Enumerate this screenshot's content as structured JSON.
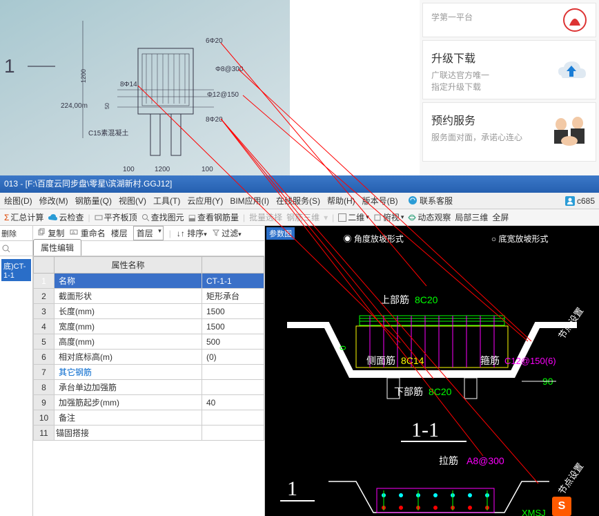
{
  "blueprint": {
    "title": "1",
    "dim1": "224,00m",
    "dim2": "1200",
    "dim3": "50",
    "c15": "C15素混凝土",
    "r1": "6Φ20",
    "r2": "Φ8@300",
    "r3": "8Φ14",
    "r4": "Φ12@150",
    "r5": "8Φ20",
    "bl1": "100",
    "bl2": "1200",
    "bl3": "100"
  },
  "cards": {
    "c0": {
      "t": "",
      "d": "学第一平台"
    },
    "c1": {
      "t": "升级下载",
      "d": "广联达官方唯一\n指定升级下载"
    },
    "c2": {
      "t": "预约服务",
      "d": "服务面对面，承诺心连心"
    }
  },
  "titlebar": "013 -  [F:\\百度云同步盘\\零星\\滨湖新村.GGJ12]",
  "menu": {
    "m0": "绘图(D)",
    "m1": "修改(M)",
    "m2": "钢筋量(Q)",
    "m3": "视图(V)",
    "m4": "工具(T)",
    "m5": "云应用(Y)",
    "m6": "BIM应用(I)",
    "m7": "在线服务(S)",
    "m8": "帮助(H)",
    "m9": "版本号(B)",
    "contact": "联系客服",
    "user": "c685"
  },
  "toolbar": {
    "t0": "汇总计算",
    "t1": "云检查",
    "t2": "平齐板顶",
    "t3": "查找图元",
    "t4": "查看钢筋量",
    "t5": "批量选择",
    "t6": "钢筋三维",
    "dim": "二维",
    "t7": "俯视",
    "t8": "动态观察",
    "t9": "局部三维",
    "t10": "全屏"
  },
  "leftbar": {
    "a0": "删除",
    "a1": "复制",
    "a2": "重命名",
    "floor": "楼层",
    "floorv": "首层",
    "sort": "排序",
    "filter": "过滤"
  },
  "tree": {
    "item0": "底)CT-1-1"
  },
  "proptab": "属性编辑",
  "propheader": {
    "name": "属性名称",
    "val": ""
  },
  "rows": [
    {
      "n": "1",
      "k": "名称",
      "v": "CT-1-1"
    },
    {
      "n": "2",
      "k": "截面形状",
      "v": "矩形承台"
    },
    {
      "n": "3",
      "k": "长度(mm)",
      "v": "1500"
    },
    {
      "n": "4",
      "k": "宽度(mm)",
      "v": "1500"
    },
    {
      "n": "5",
      "k": "高度(mm)",
      "v": "500"
    },
    {
      "n": "6",
      "k": "相对底标高(m)",
      "v": "(0)"
    },
    {
      "n": "7",
      "k": "其它钢筋",
      "v": ""
    },
    {
      "n": "8",
      "k": "承台单边加强筋",
      "v": ""
    },
    {
      "n": "9",
      "k": "加强筋起步(mm)",
      "v": "40"
    },
    {
      "n": "10",
      "k": "备注",
      "v": ""
    },
    {
      "n": "11",
      "k": "锚固搭接",
      "v": ""
    }
  ],
  "preview": {
    "opt1": "角度放坡形式",
    "opt2": "底宽放坡形式",
    "lab_top": "上部筋",
    "lab_top_v": "8C20",
    "lab_side": "侧面筋",
    "lab_side_v": "8C14",
    "lab_hoop": "箍筋",
    "lab_hoop_v": "C12@150(6)",
    "lab_bot": "下部筋",
    "lab_bot_v": "8C20",
    "lab_tie": "拉筋",
    "lab_tie_v": "A8@300",
    "sec": "1-1",
    "big1": "1",
    "dim90": "90",
    "nodeset": "节点设置",
    "xmsj": "XMSJ",
    "param": "参数图"
  },
  "ime": "S"
}
